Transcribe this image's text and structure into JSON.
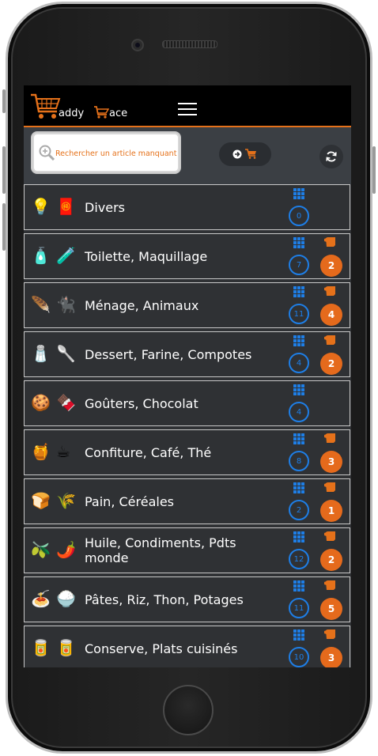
{
  "app": {
    "logo_text_1": "addy",
    "logo_text_2": "ace",
    "accent_color": "#e5711a",
    "circle_color": "#1e7ee6"
  },
  "search": {
    "placeholder": "Rechercher un article manquant",
    "value": ""
  },
  "toolbar": {
    "cart_icon": "arrow-circle-right-icon + cart-icon",
    "refresh_icon": "refresh-icon"
  },
  "categories": [
    {
      "label": "Divers",
      "emoji1": "💡",
      "emoji2": "🧧",
      "count": "0",
      "badge": ""
    },
    {
      "label": "Toilette, Maquillage",
      "emoji1": "🧴",
      "emoji2": "🧪",
      "count": "7",
      "badge": "2"
    },
    {
      "label": "Ménage, Animaux",
      "emoji1": "🪶",
      "emoji2": "🐈‍⬛",
      "count": "11",
      "badge": "4"
    },
    {
      "label": "Dessert, Farine, Compotes",
      "emoji1": "🧂",
      "emoji2": "🥄",
      "count": "4",
      "badge": "2"
    },
    {
      "label": "Goûters, Chocolat",
      "emoji1": "🍪",
      "emoji2": "🍫",
      "count": "4",
      "badge": ""
    },
    {
      "label": "Confiture, Café, Thé",
      "emoji1": "🍯",
      "emoji2": "☕",
      "count": "8",
      "badge": "3"
    },
    {
      "label": "Pain, Céréales",
      "emoji1": "🍞",
      "emoji2": "🌾",
      "count": "2",
      "badge": "1"
    },
    {
      "label": "Huile, Condiments, Pdts monde",
      "emoji1": "🫒",
      "emoji2": "🌶️",
      "count": "12",
      "badge": "2"
    },
    {
      "label": "Pâtes, Riz, Thon, Potages",
      "emoji1": "🍝",
      "emoji2": "🍚",
      "count": "11",
      "badge": "5"
    },
    {
      "label": "Conserve, Plats cuisinés",
      "emoji1": "🥫",
      "emoji2": "🥫",
      "count": "10",
      "badge": "3"
    }
  ]
}
